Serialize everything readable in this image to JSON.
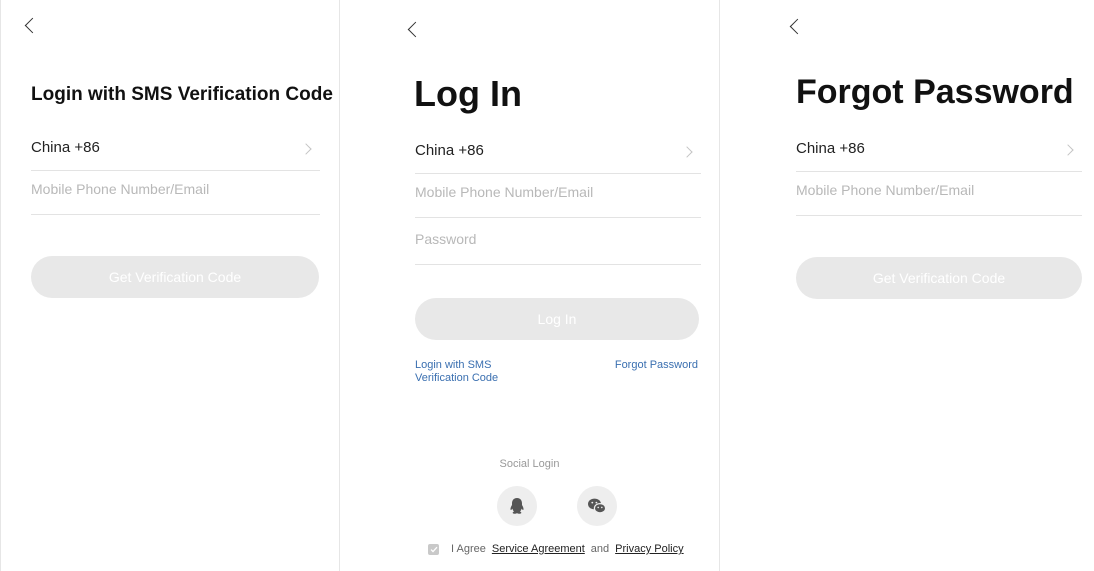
{
  "screens": {
    "sms": {
      "title": "Login with SMS Verification Code",
      "region": "China +86",
      "phone_placeholder": "Mobile Phone Number/Email",
      "submit_label": "Get Verification Code"
    },
    "login": {
      "title": "Log In",
      "region": "China +86",
      "phone_placeholder": "Mobile Phone Number/Email",
      "password_placeholder": "Password",
      "submit_label": "Log In",
      "sms_link_line1": "Login with SMS",
      "sms_link_line2": "Verification Code",
      "forgot_link": "Forgot Password",
      "social_label": "Social Login",
      "social_icons": [
        "qq-icon",
        "wechat-icon"
      ],
      "agree_prefix": "I Agree",
      "service_agreement": "Service Agreement",
      "agree_and": "and",
      "privacy_policy": "Privacy Policy",
      "agree_checked": true
    },
    "forgot": {
      "title": "Forgot Password",
      "region": "China +86",
      "phone_placeholder": "Mobile Phone Number/Email",
      "submit_label": "Get Verification Code"
    }
  },
  "colors": {
    "disabled_button": "#e8e8e8",
    "link": "#3a6fb0",
    "divider": "#e3e3e3",
    "placeholder": "#b8b8b8"
  }
}
